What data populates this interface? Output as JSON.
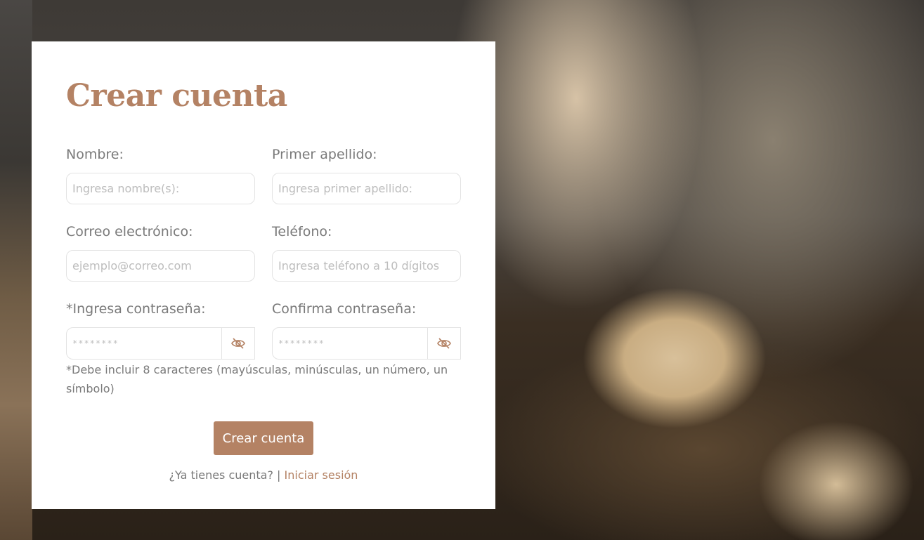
{
  "form": {
    "title": "Crear cuenta",
    "fields": {
      "nombre": {
        "label": "Nombre:",
        "placeholder": "Ingresa nombre(s):"
      },
      "apellido": {
        "label": "Primer apellido:",
        "placeholder": "Ingresa primer apellido:"
      },
      "correo": {
        "label": "Correo electrónico:",
        "placeholder": "ejemplo@correo.com"
      },
      "telefono": {
        "label": "Teléfono:",
        "placeholder": "Ingresa teléfono a 10 dígitos"
      },
      "password": {
        "label": "*Ingresa contraseña:",
        "placeholder": "********"
      },
      "confirm_password": {
        "label": "Confirma contraseña:",
        "placeholder": "********"
      }
    },
    "password_hint": "*Debe incluir 8 caracteres (mayúsculas, minúsculas, un número, un símbolo)",
    "submit_label": "Crear cuenta",
    "login_prompt": "¿Ya tienes cuenta? |",
    "login_link": "Iniciar sesión"
  },
  "icons": {
    "toggle": "eye-off-icon"
  },
  "colors": {
    "accent": "#b48264",
    "label": "#7a7a7a",
    "placeholder": "#bdbdbd",
    "border": "#e3e3e3"
  }
}
